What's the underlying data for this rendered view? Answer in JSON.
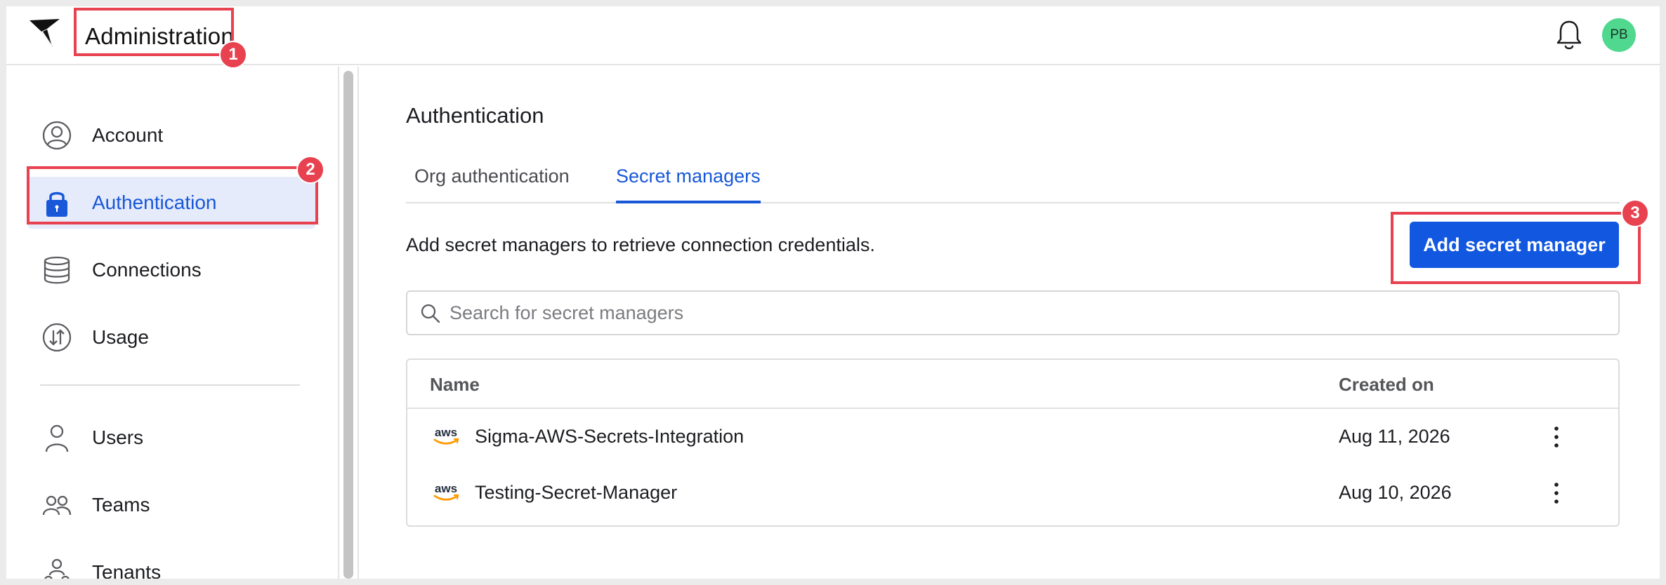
{
  "header": {
    "title": "Administration",
    "avatar_initials": "PB"
  },
  "sidebar": {
    "items": [
      {
        "label": "Account",
        "icon": "user-circle-icon"
      },
      {
        "label": "Authentication",
        "icon": "lock-icon",
        "active": true
      },
      {
        "label": "Connections",
        "icon": "database-icon"
      },
      {
        "label": "Usage",
        "icon": "usage-icon"
      },
      {
        "label": "Users",
        "icon": "user-icon"
      },
      {
        "label": "Teams",
        "icon": "teams-icon"
      },
      {
        "label": "Tenants",
        "icon": "tenants-icon"
      }
    ]
  },
  "main": {
    "title": "Authentication",
    "tabs": [
      {
        "label": "Org authentication"
      },
      {
        "label": "Secret managers",
        "active": true
      }
    ],
    "description": "Add secret managers to retrieve connection credentials.",
    "add_button_label": "Add secret manager",
    "search": {
      "placeholder": "Search for secret managers",
      "value": ""
    },
    "table": {
      "columns": [
        "Name",
        "Created on"
      ],
      "rows": [
        {
          "provider": "aws",
          "name": "Sigma-AWS-Secrets-Integration",
          "created_on": "Aug 11, 2026"
        },
        {
          "provider": "aws",
          "name": "Testing-Secret-Manager",
          "created_on": "Aug 10, 2026"
        }
      ]
    }
  },
  "annotations": [
    {
      "number": "1"
    },
    {
      "number": "2"
    },
    {
      "number": "3"
    }
  ],
  "colors": {
    "accent": "#1157e0",
    "active_bg": "#e5ebfb",
    "annotation": "#e8414f",
    "avatar": "#4fd88e"
  }
}
